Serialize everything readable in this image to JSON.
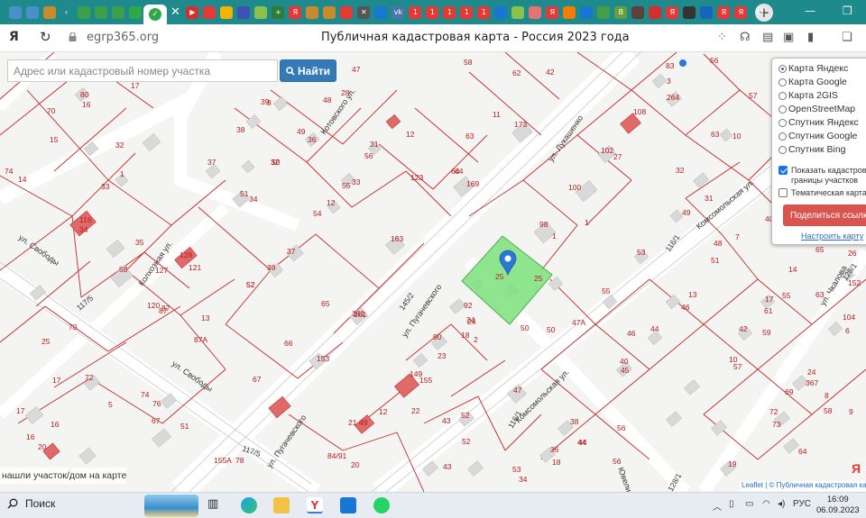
{
  "browser": {
    "url": "egrp365.org",
    "page_title": "Публичная кадастровая карта - Россия 2023 года",
    "logo_letter": "Я",
    "colors": {
      "tabstrip": "#1f8a8c",
      "accent": "#337ab7"
    },
    "tab_icons": [
      {
        "icon": "home-icon",
        "color": "#4a90c8",
        "label": ""
      },
      {
        "icon": "home-icon",
        "color": "#4a90c8",
        "label": ""
      },
      {
        "icon": "stack-icon",
        "color": "#c88a2a",
        "label": ""
      },
      {
        "icon": "back-icon",
        "color": "#1f8a8c",
        "label": "‹"
      },
      {
        "icon": "logo-icon",
        "color": "#3aa04a",
        "label": ""
      },
      {
        "icon": "logo-icon",
        "color": "#3aa04a",
        "label": ""
      },
      {
        "icon": "check-icon",
        "color": "#3aa04a",
        "label": ""
      },
      {
        "icon": "check-icon",
        "color": "#2ea84a",
        "label": ""
      }
    ],
    "tab_icons_after": [
      {
        "icon": "video-icon",
        "color": "#d32f2f",
        "label": "▶"
      },
      {
        "icon": "play-icon",
        "color": "#e53935",
        "label": ""
      },
      {
        "icon": "mail-icon",
        "color": "#f4b400",
        "label": ""
      },
      {
        "icon": "star-icon",
        "color": "#3f51b5",
        "label": ""
      },
      {
        "icon": "bag-icon",
        "color": "#8bc34a",
        "label": ""
      },
      {
        "icon": "cross-icon",
        "color": "#2e7d32",
        "label": "+"
      },
      {
        "icon": "yandex-icon",
        "color": "#e53935",
        "label": "Я"
      },
      {
        "icon": "stack-icon",
        "color": "#c88a2a",
        "label": ""
      },
      {
        "icon": "stack-icon",
        "color": "#c88a2a",
        "label": ""
      },
      {
        "icon": "pin-icon",
        "color": "#e53935",
        "label": ""
      },
      {
        "icon": "tools-icon",
        "color": "#555555",
        "label": "✕"
      },
      {
        "icon": "image-icon",
        "color": "#1976d2",
        "label": ""
      },
      {
        "icon": "vk-icon",
        "color": "#4a76a8",
        "label": "vk"
      },
      {
        "icon": "badge-icon",
        "color": "#e53935",
        "label": "1"
      },
      {
        "icon": "badge-icon",
        "color": "#e53935",
        "label": "1"
      },
      {
        "icon": "badge-icon",
        "color": "#e53935",
        "label": "1"
      },
      {
        "icon": "badge-icon",
        "color": "#e53935",
        "label": "1"
      },
      {
        "icon": "badge-icon",
        "color": "#e53935",
        "label": "1"
      },
      {
        "icon": "chart-icon",
        "color": "#1976d2",
        "label": ""
      },
      {
        "icon": "leaf-icon",
        "color": "#8bc34a",
        "label": ""
      },
      {
        "icon": "circle-icon",
        "color": "#e57373",
        "label": ""
      },
      {
        "icon": "yandex-icon",
        "color": "#e53935",
        "label": "Я"
      },
      {
        "icon": "globe-icon",
        "color": "#f57c00",
        "label": ""
      },
      {
        "icon": "doc-icon",
        "color": "#1976d2",
        "label": ""
      },
      {
        "icon": "leaf-icon",
        "color": "#43a047",
        "label": ""
      },
      {
        "icon": "b-icon",
        "color": "#689f38",
        "label": "B"
      },
      {
        "icon": "box-icon",
        "color": "#5d4037",
        "label": ""
      },
      {
        "icon": "flag-icon",
        "color": "#d32f2f",
        "label": ""
      },
      {
        "icon": "yandex-icon",
        "color": "#e53935",
        "label": "Я"
      },
      {
        "icon": "clock-icon",
        "color": "#333333",
        "label": ""
      },
      {
        "icon": "mail-icon",
        "color": "#1565c0",
        "label": ""
      },
      {
        "icon": "yandex-icon",
        "color": "#e53935",
        "label": "Я"
      },
      {
        "icon": "yandex-icon",
        "color": "#e53935",
        "label": "Я"
      }
    ]
  },
  "map": {
    "search": {
      "placeholder": "Адрес или кадастровый номер участка",
      "button_label": "Найти"
    },
    "layers": [
      {
        "label": "Карта Яндекс",
        "selected": true
      },
      {
        "label": "Карта Google",
        "selected": false
      },
      {
        "label": "Карта 2GIS",
        "selected": false
      },
      {
        "label": "OpenStreetMap",
        "selected": false
      },
      {
        "label": "Спутник Яндекс",
        "selected": false
      },
      {
        "label": "Спутник Google",
        "selected": false
      },
      {
        "label": "Спутник Bing",
        "selected": false
      }
    ],
    "show_borders": {
      "line1": "Показать кадастровые",
      "line2": "границы участков",
      "checked": true
    },
    "thematic": {
      "label": "Тематическая карта",
      "checked": false
    },
    "share_button": "Поделиться ссылкой",
    "configure_link": "Настроить карту",
    "help_tip": "нашли участок/дом на карте?",
    "attribution": "Leaflet | © Публичная кадастровая карта",
    "colors": {
      "parcel_border": "#c62828",
      "building": "#d9d9d9",
      "residential_building": "#e06a6a",
      "selected_parcel": "#7de07d",
      "road": "#ffffff",
      "marker": "#2a78d6"
    },
    "street_labels": [
      {
        "text": "ул. Свободы"
      },
      {
        "text": "ул. Свободы"
      },
      {
        "text": "Котовского ул."
      },
      {
        "text": "ул. Пугачевского"
      },
      {
        "text": "ул. Пугачевского"
      },
      {
        "text": "ул. Лукашенко"
      },
      {
        "text": "Комсомольская ул."
      },
      {
        "text": "Комсомольская ул."
      },
      {
        "text": "Колхозная ул."
      },
      {
        "text": "ул. Чкалова"
      },
      {
        "text": "Ювелирская ул."
      }
    ],
    "parcel_numbers": [
      "47",
      "58",
      "62",
      "42",
      "17",
      "80",
      "16",
      "48",
      "28",
      "70",
      "39",
      "8",
      "49",
      "36",
      "12",
      "32",
      "15",
      "38",
      "31",
      "32",
      "64",
      "50",
      "56",
      "33",
      "1",
      "55",
      "14",
      "74",
      "33",
      "37",
      "51",
      "34",
      "116",
      "34",
      "35",
      "58",
      "39",
      "123",
      "127",
      "128",
      "121",
      "54",
      "163",
      "37",
      "12",
      "52",
      "52",
      "65",
      "24",
      "2",
      "18",
      "13",
      "87",
      "120",
      "87",
      "87А",
      "161",
      "161",
      "66",
      "153",
      "67",
      "43",
      "149",
      "155",
      "22",
      "12",
      "5",
      "72",
      "17",
      "76",
      "51",
      "17",
      "25",
      "74",
      "70",
      "20",
      "49",
      "21",
      "84/91",
      "20",
      "67",
      "16",
      "16",
      "155А",
      "78",
      "5",
      "173",
      "11",
      "63",
      "64",
      "169",
      "100",
      "102",
      "27",
      "98",
      "1",
      "25",
      "25",
      "92",
      "24",
      "50",
      "50",
      "90",
      "23",
      "47",
      "52",
      "52",
      "43",
      "53",
      "36",
      "18",
      "38",
      "44",
      "44",
      "56",
      "56",
      "55",
      "49",
      "53",
      "51",
      "48",
      "13",
      "46",
      "42",
      "46",
      "44",
      "40",
      "45",
      "57",
      "59",
      "61",
      "55",
      "65",
      "63",
      "73",
      "72",
      "64",
      "58",
      "24",
      "367",
      "9",
      "6",
      "8",
      "14",
      "40",
      "7",
      "31",
      "32",
      "57",
      "63",
      "10",
      "104",
      "152",
      "108",
      "264",
      "3",
      "83",
      "56",
      "10",
      "26",
      "1",
      "47А",
      "17",
      "19",
      "69",
      "34"
    ],
    "labels_misc": {
      "road_label_1": "117/5",
      "road_label_2": "145/2",
      "road_label_3": "116/1",
      "road_label_4": "128/1",
      "road_label_5": "116/1",
      "road_label_6": "117/5",
      "road_label_7": "128/1"
    }
  },
  "taskbar": {
    "search_label": "Поиск",
    "lang": "РУС",
    "time": "16:09",
    "date": "06.09.2023"
  }
}
